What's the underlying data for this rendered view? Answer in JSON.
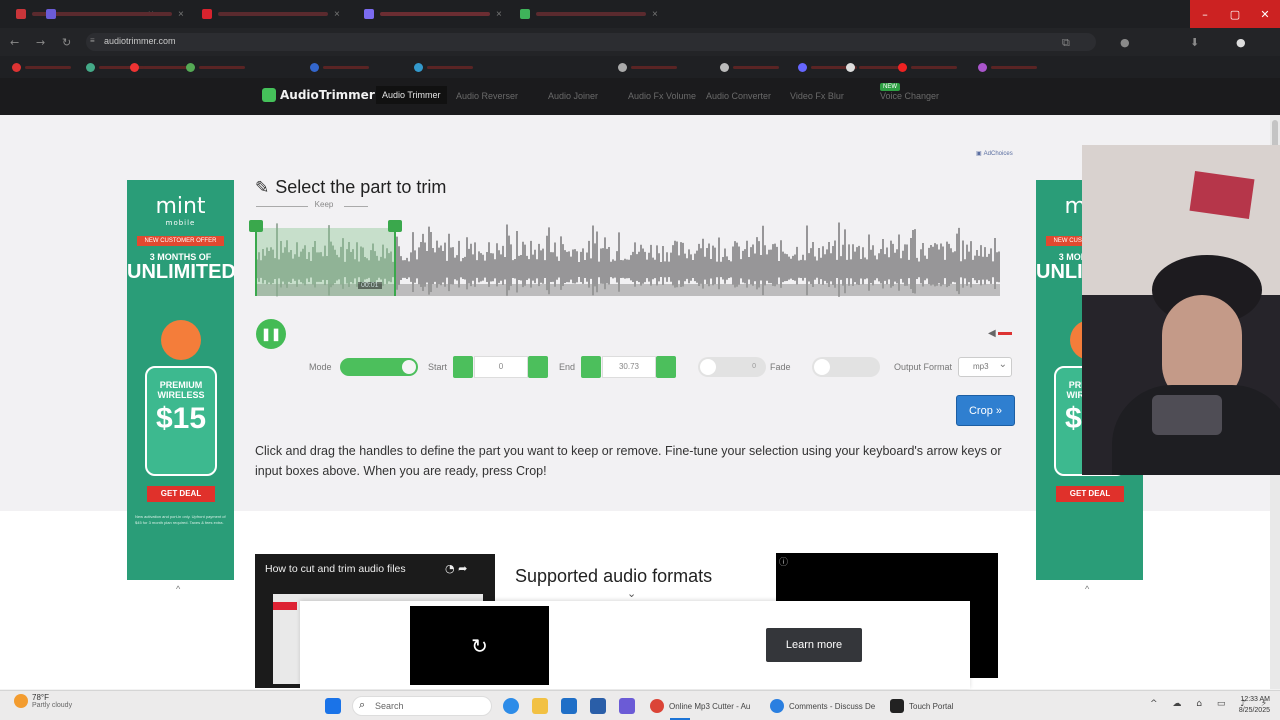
{
  "browser": {
    "url": "audiotrimmer.com",
    "window_controls": {
      "minimize": "–",
      "maximize": "▢",
      "close": "✕"
    }
  },
  "site_nav": {
    "logo": "AudioTrimmer",
    "items": [
      "Audio Trimmer",
      "Audio Reverser",
      "Audio Joiner",
      "Audio Fx Volume",
      "Audio Converter",
      "Video Fx Blur",
      "Voice Changer"
    ],
    "new_badge": "NEW"
  },
  "editor": {
    "title": "Select the part to trim",
    "keep_label": "Keep",
    "timecode": "00:01",
    "play_icon": "pause-icon",
    "controls": {
      "mode_label": "Mode",
      "start_label": "Start",
      "start_value": "0",
      "end_label": "End",
      "end_value": "30.73",
      "fade_in_value": "0",
      "fade_out_label": "Fade",
      "output_label": "Output Format",
      "output_value": "mp3"
    },
    "crop_button": "Crop »",
    "help_text": "Click and drag the handles to define the part you want to keep or remove. Fine-tune your selection using your keyboard's arrow keys or input boxes above. When you are ready, press Crop!"
  },
  "ads": {
    "adchoices": "AdChoices",
    "left": {
      "brand": "mint",
      "brand_sub": "mobile",
      "tag": "NEW CUSTOMER OFFER",
      "headline_small": "3 MONTHS OF",
      "headline": "UNLIMITED",
      "card_label": "PREMIUM WIRELESS",
      "price": "$15",
      "cta": "GET DEAL",
      "fine_print": "New activation and port-in only. Upfront payment of $45 for 3 month plan required. Taxes & fees extra."
    },
    "right": {
      "brand": "mint",
      "tag": "NEW CUSTOMER OFFER",
      "headline_small": "3 MONTHS OF",
      "headline": "UNLIMITED",
      "card_label": "PREMIUM WIRELESS",
      "price": "$15",
      "cta": "GET DEAL"
    },
    "collapse_icon": "chevron-up-icon"
  },
  "lower": {
    "video_title": "How to cut and trim audio files",
    "formats_title": "Supported audio formats",
    "overlay_learn_more": "Learn more",
    "overlay_replay_icon": "↻"
  },
  "taskbar": {
    "weather_temp": "78°F",
    "weather_desc": "Partly cloudy",
    "search_placeholder": "Search",
    "apps": [
      {
        "label": "Online Mp3 Cutter - Au",
        "color": "#db4437"
      },
      {
        "label": "Comments - Discuss De",
        "color": "#2a7fe0"
      },
      {
        "label": "Touch Portal",
        "color": "#222222"
      }
    ],
    "time": "12:33 AM",
    "date": "8/25/2025"
  },
  "colors": {
    "accent_green": "#4cbf5c",
    "crop_blue": "#2f7fd0",
    "ad_green": "#2a9d78"
  }
}
